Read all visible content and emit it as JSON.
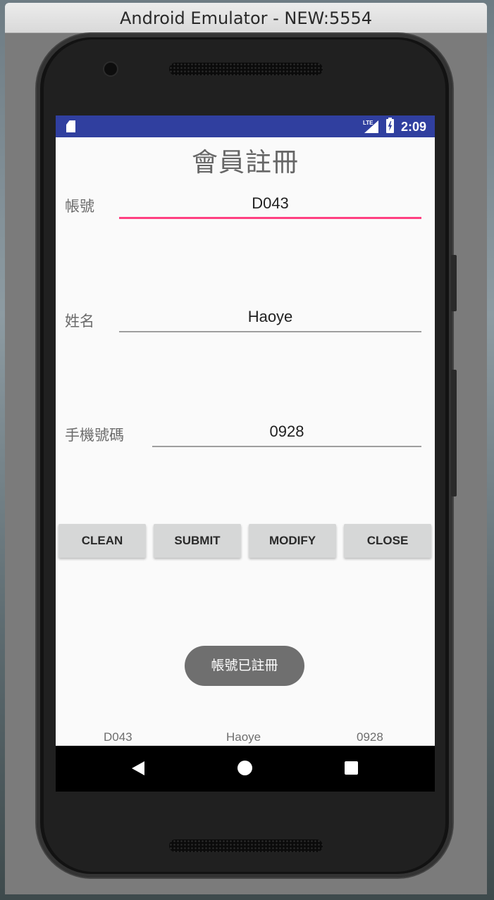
{
  "window": {
    "title": "Android Emulator - NEW:5554"
  },
  "statusbar": {
    "network": "LTE",
    "time": "2:09"
  },
  "app": {
    "title": "會員註冊",
    "fields": [
      {
        "label": "帳號",
        "value": "D043",
        "focused": true
      },
      {
        "label": "姓名",
        "value": "Haoye",
        "focused": false
      },
      {
        "label": "手機號碼",
        "value": "0928",
        "focused": false
      }
    ],
    "buttons": {
      "clean": "CLEAN",
      "submit": "SUBMIT",
      "modify": "MODIFY",
      "close": "CLOSE"
    },
    "toast": "帳號已註冊",
    "output": {
      "account": "D043",
      "name": "Haoye",
      "phone": "0928"
    }
  },
  "colors": {
    "statusbar": "#303f9f",
    "accent": "#ff4081",
    "button_bg": "#d6d7d7",
    "toast_bg": "#6f6f6f"
  },
  "icons": [
    "sd-card-icon",
    "lte-signal-icon",
    "battery-charging-icon",
    "back-icon",
    "home-icon",
    "recents-icon"
  ]
}
